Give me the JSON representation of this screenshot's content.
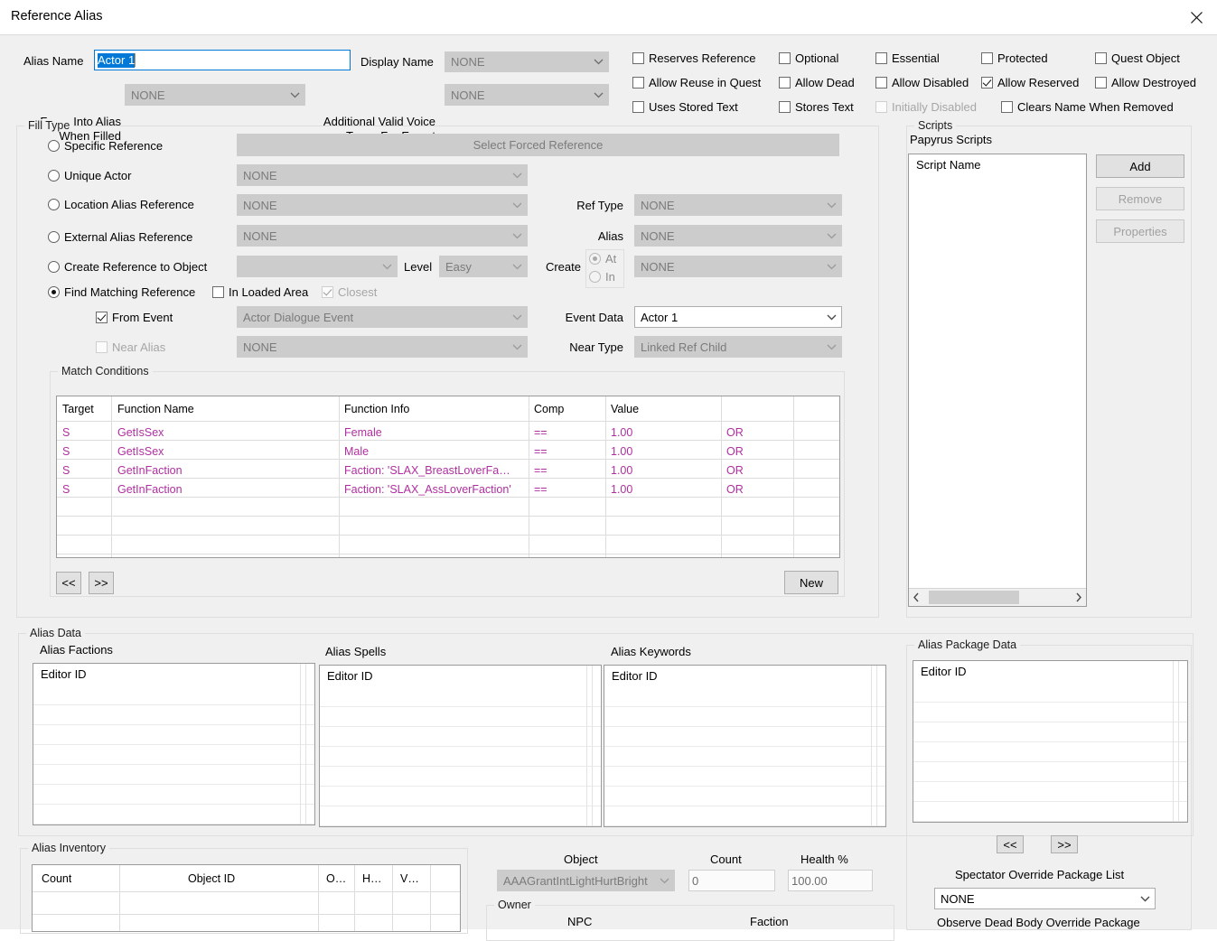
{
  "window": {
    "title": "Reference Alias",
    "close_icon": "close-icon"
  },
  "header": {
    "alias_name_label": "Alias Name",
    "alias_name_value": "Actor 1",
    "display_name_label": "Display Name",
    "display_name_value": "NONE",
    "force_into_alias_label_line1": "Force Into Alias",
    "force_into_alias_label_line2": "When Filled",
    "force_into_alias_value": "NONE",
    "additional_voice_label_line1": "Additional Valid Voice",
    "additional_voice_label_line2": "Types For Export",
    "additional_voice_value": "NONE"
  },
  "flags": [
    {
      "label": "Reserves Reference",
      "checked": false,
      "disabled": false
    },
    {
      "label": "Optional",
      "checked": false,
      "disabled": false
    },
    {
      "label": "Essential",
      "checked": false,
      "disabled": false
    },
    {
      "label": "Protected",
      "checked": false,
      "disabled": false
    },
    {
      "label": "Quest Object",
      "checked": false,
      "disabled": false
    },
    {
      "label": "Allow Reuse in Quest",
      "checked": false,
      "disabled": false
    },
    {
      "label": "Allow Dead",
      "checked": false,
      "disabled": false
    },
    {
      "label": "Allow Disabled",
      "checked": false,
      "disabled": false
    },
    {
      "label": "Allow Reserved",
      "checked": true,
      "disabled": false
    },
    {
      "label": "Allow Destroyed",
      "checked": false,
      "disabled": false
    },
    {
      "label": "Uses Stored Text",
      "checked": false,
      "disabled": false
    },
    {
      "label": "Stores Text",
      "checked": false,
      "disabled": false
    },
    {
      "label": "Initially Disabled",
      "checked": false,
      "disabled": true
    },
    {
      "label": "Clears Name When Removed",
      "checked": false,
      "disabled": false
    }
  ],
  "fill_type": {
    "title": "Fill Type",
    "options": [
      {
        "label": "Specific Reference",
        "selected": false
      },
      {
        "label": "Unique Actor",
        "selected": false
      },
      {
        "label": "Location Alias Reference",
        "selected": false
      },
      {
        "label": "External Alias Reference",
        "selected": false
      },
      {
        "label": "Create Reference to Object",
        "selected": false
      },
      {
        "label": "Find Matching Reference",
        "selected": true
      }
    ],
    "forced_ref_button": "Select Forced Reference",
    "unique_actor_value": "NONE",
    "location_alias_value": "NONE",
    "external_alias_value": "NONE",
    "create_ref_object_value": "",
    "level_label": "Level",
    "level_value": "Easy",
    "in_loaded_area_label": "In Loaded Area",
    "in_loaded_area_checked": false,
    "closest_label": "Closest",
    "closest_checked": true,
    "from_event_label": "From Event",
    "from_event_checked": true,
    "from_event_value": "Actor Dialogue Event",
    "near_alias_label": "Near Alias",
    "near_alias_checked": false,
    "near_alias_value": "NONE",
    "ref_type_label": "Ref Type",
    "ref_type_value": "NONE",
    "alias_label": "Alias",
    "alias_value": "NONE",
    "create_label": "Create",
    "create_at_label": "At",
    "create_in_label": "In",
    "create_at_selected": true,
    "create_value": "NONE",
    "event_data_label": "Event Data",
    "event_data_value": "Actor 1",
    "near_type_label": "Near Type",
    "near_type_value": "Linked Ref Child"
  },
  "match_conditions": {
    "title": "Match Conditions",
    "columns": [
      "Target",
      "Function Name",
      "Function Info",
      "Comp",
      "Value",
      "",
      ""
    ],
    "rows": [
      {
        "target": "S",
        "function_name": "GetIsSex",
        "function_info": "Female",
        "comp": "==",
        "value": "1.00",
        "logic": "OR"
      },
      {
        "target": "S",
        "function_name": "GetIsSex",
        "function_info": "Male",
        "comp": "==",
        "value": "1.00",
        "logic": "OR"
      },
      {
        "target": "S",
        "function_name": "GetInFaction",
        "function_info": "Faction: 'SLAX_BreastLoverFa…",
        "comp": "==",
        "value": "1.00",
        "logic": "OR"
      },
      {
        "target": "S",
        "function_name": "GetInFaction",
        "function_info": "Faction: 'SLAX_AssLoverFaction'",
        "comp": "==",
        "value": "1.00",
        "logic": "OR"
      }
    ],
    "prev_button": "<<",
    "next_button": ">>",
    "new_button": "New"
  },
  "scripts": {
    "group_title": "Scripts",
    "papyrus_label": "Papyrus Scripts",
    "column_header": "Script Name",
    "items": [],
    "add_button": "Add",
    "remove_button": "Remove",
    "properties_button": "Properties"
  },
  "alias_data": {
    "title": "Alias Data",
    "panels": [
      {
        "label": "Alias Factions",
        "column_header": "Editor ID",
        "items": []
      },
      {
        "label": "Alias Spells",
        "column_header": "Editor ID",
        "items": []
      },
      {
        "label": "Alias Keywords",
        "column_header": "Editor ID",
        "items": []
      }
    ]
  },
  "alias_package_data": {
    "title": "Alias Package Data",
    "column_header": "Editor ID",
    "items": [],
    "prev_button": "<<",
    "next_button": ">>",
    "spectator_label": "Spectator Override Package List",
    "spectator_value": "NONE",
    "observe_label": "Observe Dead Body Override Package"
  },
  "alias_inventory": {
    "title": "Alias Inventory",
    "columns": [
      "Count",
      "Object ID",
      "O…",
      "H…",
      "V…",
      ""
    ],
    "rows": [],
    "object_label": "Object",
    "object_value": "AAAGrantIntLightHurtBright",
    "count_label": "Count",
    "count_value": "0",
    "health_label": "Health %",
    "health_value": "100.00",
    "owner_title": "Owner",
    "owner_npc_label": "NPC",
    "owner_faction_label": "Faction"
  },
  "colors": {
    "accent": "#0078d7",
    "dialog_bg": "#f0f0f0",
    "row_text": "#b02fa0"
  }
}
